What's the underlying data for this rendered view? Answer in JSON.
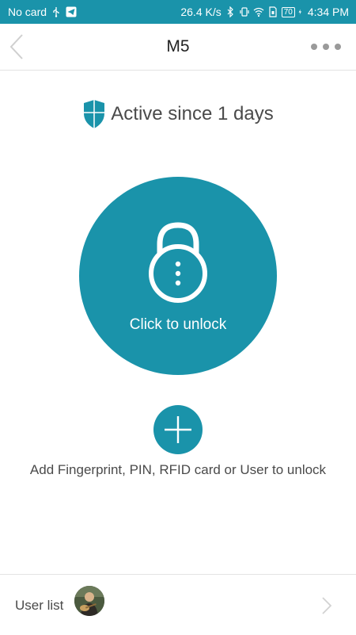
{
  "status_bar": {
    "carrier": "No card",
    "speed": "26.4 K/s",
    "battery": "70",
    "time": "4:34 PM",
    "icons": [
      "usb-icon",
      "telegram-icon",
      "bluetooth-icon",
      "vibrate-icon",
      "wifi-icon",
      "sim-icon",
      "battery-icon",
      "charging-icon"
    ]
  },
  "header": {
    "title": "M5",
    "back_icon": "chevron-left-icon",
    "more_icon": "more-dots-icon"
  },
  "status": {
    "text": "Active since 1 days",
    "icon": "shield-icon"
  },
  "unlock": {
    "label": "Click to unlock",
    "icon": "lock-icon"
  },
  "add": {
    "icon": "plus-icon",
    "hint": "Add Fingerprint, PIN, RFID card or User to unlock"
  },
  "bottom": {
    "user_list_label": "User list",
    "avatar": "avatar",
    "chevron_icon": "chevron-right-icon"
  },
  "colors": {
    "accent": "#1a93aa",
    "text": "#4a4a4a",
    "divider": "#e3e3e3"
  }
}
